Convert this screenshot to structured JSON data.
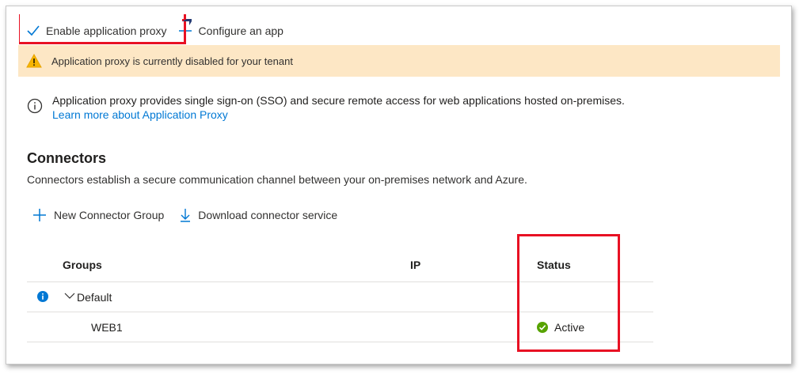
{
  "toolbar": {
    "enable_label": "Enable application proxy",
    "configure_label": "Configure an app"
  },
  "warning": {
    "text": "Application proxy is currently disabled for your tenant"
  },
  "info": {
    "text": "Application proxy provides single sign-on (SSO) and secure remote access for web applications hosted on-premises.",
    "link": "Learn more about Application Proxy"
  },
  "connectors": {
    "title": "Connectors",
    "description": "Connectors establish a secure communication channel between your on-premises network and Azure.",
    "new_group_label": "New Connector Group",
    "download_label": "Download connector service"
  },
  "table": {
    "headers": {
      "groups": "Groups",
      "ip": "IP",
      "status": "Status"
    },
    "group_name": "Default",
    "rows": [
      {
        "name": "WEB1",
        "ip": "",
        "status": "Active"
      }
    ]
  },
  "colors": {
    "accent": "#0078d4",
    "warning_bg": "#fde7c5",
    "highlight": "#e81123",
    "active_green": "#57a300"
  }
}
